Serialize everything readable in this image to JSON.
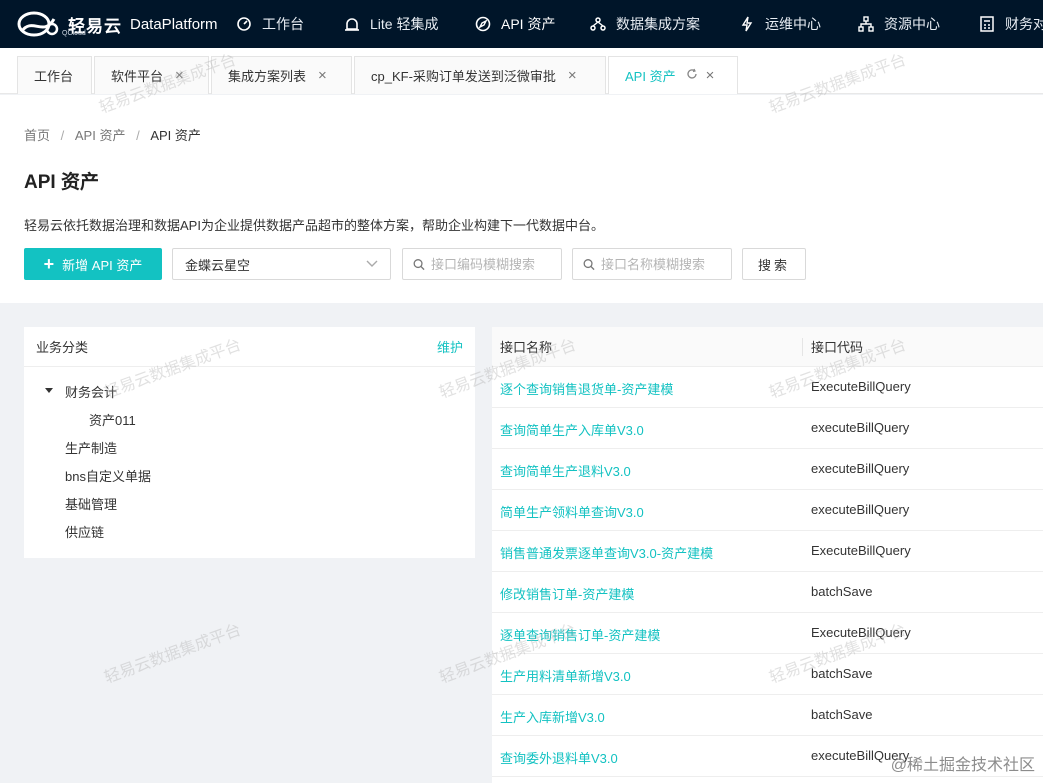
{
  "brand": {
    "name": "轻易云",
    "sub": "QCloud",
    "platform": "DataPlatform"
  },
  "nav": [
    {
      "icon": "dashboard-icon",
      "label": "工作台"
    },
    {
      "icon": "alarm-icon",
      "label": "Lite 轻集成"
    },
    {
      "icon": "compass-icon",
      "label": "API 资产"
    },
    {
      "icon": "cluster-icon",
      "label": "数据集成方案"
    },
    {
      "icon": "lightning-icon",
      "label": "运维中心"
    },
    {
      "icon": "apartment-icon",
      "label": "资源中心"
    },
    {
      "icon": "calculator-icon",
      "label": "财务对"
    }
  ],
  "tabs": [
    {
      "label": "工作台",
      "closable": false
    },
    {
      "label": "软件平台",
      "closable": true
    },
    {
      "label": "集成方案列表",
      "closable": true
    },
    {
      "label": "cp_KF-采购订单发送到泛微审批",
      "closable": true
    },
    {
      "label": "API 资产",
      "closable": true,
      "active": true
    }
  ],
  "breadcrumb": {
    "home": "首页",
    "mid": "API 资产",
    "current": "API 资产",
    "sep": "/"
  },
  "page": {
    "title": "API 资产",
    "description": "轻易云依托数据治理和数据API为企业提供数据产品超市的整体方案，帮助企业构建下一代数据中台。"
  },
  "toolbar": {
    "add_label": "新增 API 资产",
    "select_value": "金蝶云星空",
    "code_placeholder": "接口编码模糊搜索",
    "name_placeholder": "接口名称模糊搜索",
    "search_label": "搜索"
  },
  "category": {
    "title": "业务分类",
    "action": "维护",
    "tree": {
      "root": "财务会计",
      "child": "资产011",
      "others": [
        "生产制造",
        "bns自定义单据",
        "基础管理",
        "供应链"
      ]
    }
  },
  "table": {
    "columns": [
      "接口名称",
      "接口代码"
    ],
    "rows": [
      {
        "name": "逐个查询销售退货单-资产建模",
        "code": "ExecuteBillQuery"
      },
      {
        "name": "查询简单生产入库单V3.0",
        "code": "executeBillQuery"
      },
      {
        "name": "查询简单生产退料V3.0",
        "code": "executeBillQuery"
      },
      {
        "name": "简单生产领料单查询V3.0",
        "code": "executeBillQuery"
      },
      {
        "name": "销售普通发票逐单查询V3.0-资产建模",
        "code": "ExecuteBillQuery"
      },
      {
        "name": "修改销售订单-资产建模",
        "code": "batchSave"
      },
      {
        "name": "逐单查询销售订单-资产建模",
        "code": "ExecuteBillQuery"
      },
      {
        "name": "生产用料清单新增V3.0",
        "code": "batchSave"
      },
      {
        "name": "生产入库新增V3.0",
        "code": "batchSave"
      },
      {
        "name": "查询委外退料单V3.0",
        "code": "executeBillQuery"
      }
    ]
  },
  "watermark": "轻易云数据集成平台",
  "corner_mark": "@稀土掘金技术社区",
  "colors": {
    "accent": "#13c2c2",
    "nav_bg": "#001529"
  }
}
